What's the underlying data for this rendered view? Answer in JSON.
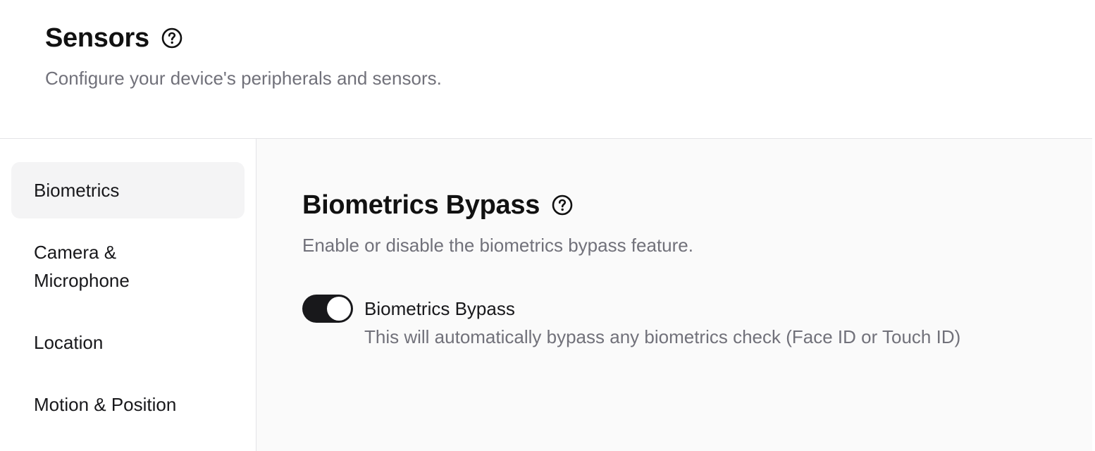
{
  "header": {
    "title": "Sensors",
    "subtitle": "Configure your device's peripherals and sensors."
  },
  "sidebar": {
    "items": [
      {
        "label": "Biometrics",
        "active": true
      },
      {
        "label": "Camera & Microphone",
        "active": false
      },
      {
        "label": "Location",
        "active": false
      },
      {
        "label": "Motion & Position",
        "active": false
      }
    ]
  },
  "main": {
    "section_title": "Biometrics Bypass",
    "section_description": "Enable or disable the biometrics bypass feature.",
    "toggle": {
      "label": "Biometrics Bypass",
      "description": "This will automatically bypass any biometrics check (Face ID or Touch ID)",
      "enabled": true
    }
  },
  "icons": {
    "help": "question-circle-icon"
  },
  "colors": {
    "toggle_on": "#18181b",
    "active_nav_bg": "#f4f4f5",
    "muted_text": "#71717a"
  }
}
